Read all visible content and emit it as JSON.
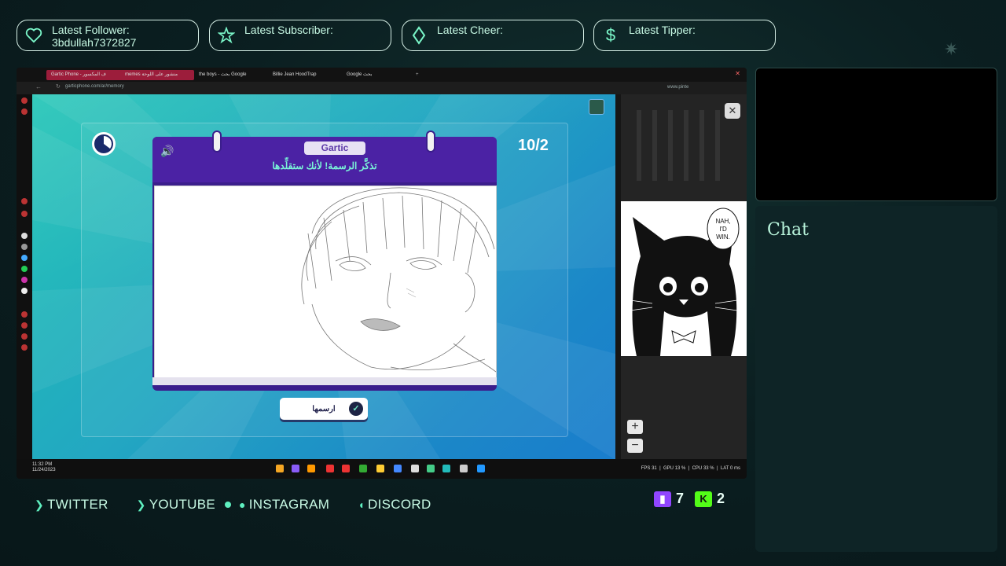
{
  "alerts": [
    {
      "icon": "heart-icon",
      "label": "Latest Follower:",
      "value": "3bdullah7372827"
    },
    {
      "icon": "star-icon",
      "label": "Latest Subscriber:",
      "value": ""
    },
    {
      "icon": "diamond-icon",
      "label": "Latest Cheer:",
      "value": ""
    },
    {
      "icon": "dollar-icon",
      "label": "Latest Tipper:",
      "value": ""
    }
  ],
  "browser": {
    "tabs": [
      {
        "label": "Gartic Phone - ف المكسور",
        "active": true
      },
      {
        "label": "memes منشور على اللوحة",
        "active": true
      },
      {
        "label": "the boys - بحث Google",
        "active": false
      },
      {
        "label": "Billie Jean HoodTrap",
        "active": false
      },
      {
        "label": "Google بحث",
        "active": false
      }
    ],
    "url": "garticphone.com/ar/memory",
    "url2": "www.pinte"
  },
  "game": {
    "counter": "10/2",
    "logo": "Gartic",
    "prompt": "تذكَّر الرسمة! لأنك ستقلِّدها",
    "draw_button": "ارسمها"
  },
  "meme": {
    "bubble": "NAH, I'D WIN."
  },
  "taskbar": {
    "time": "11:32 PM",
    "date": "11/24/2023",
    "fps_label": "FPS",
    "fps": "31",
    "gpu_label": "GPU",
    "gpu": "13 %",
    "cpu_label": "CPU",
    "cpu": "33 %",
    "lat_label": "LAT",
    "lat": "0 ms"
  },
  "chat": {
    "title": "Chat"
  },
  "socials": [
    {
      "label": "TWITTER"
    },
    {
      "label": "YOUTUBE"
    },
    {
      "label": "INSTAGRAM"
    },
    {
      "label": "DISCORD"
    }
  ],
  "counts": {
    "twitch": "7",
    "kick": "2"
  },
  "colors": {
    "accent": "#5ff0c0",
    "bg": "#0a1c1e",
    "game_purple": "#4b22a4",
    "twitch": "#9146ff",
    "kick": "#53fc18"
  }
}
